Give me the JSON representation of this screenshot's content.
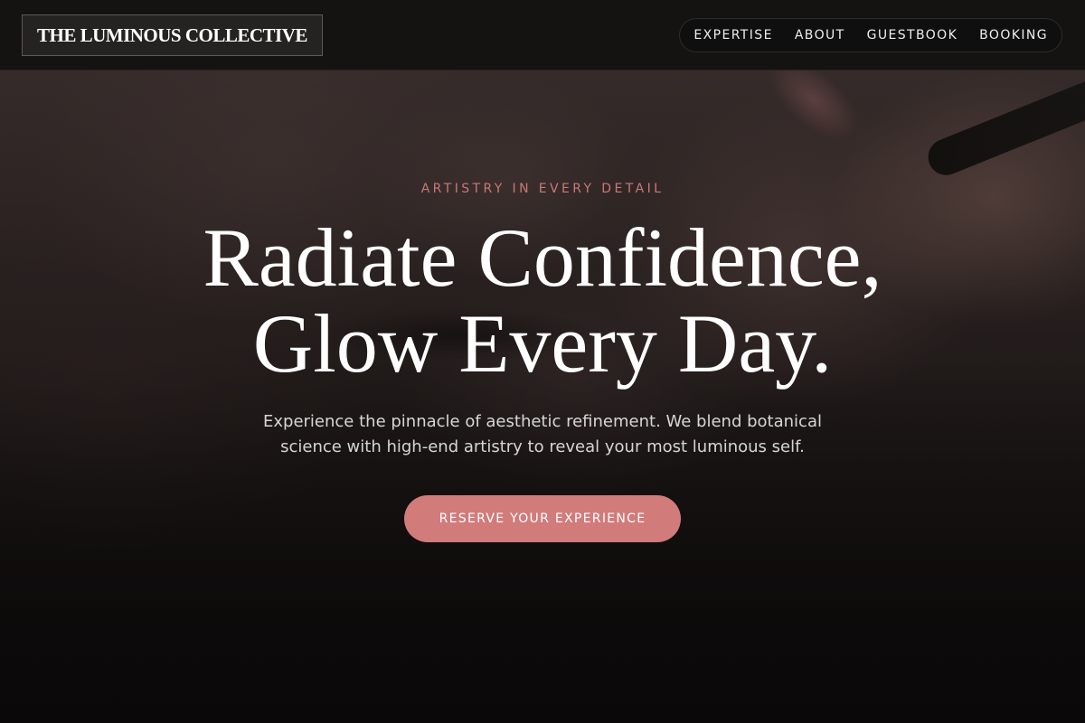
{
  "header": {
    "logo_text": "THE LUMINOUS COLLECTIVE",
    "nav": [
      {
        "label": "EXPERTISE"
      },
      {
        "label": "ABOUT"
      },
      {
        "label": "GUESTBOOK"
      },
      {
        "label": "BOOKING"
      }
    ]
  },
  "hero": {
    "eyebrow": "ARTISTRY IN EVERY DETAIL",
    "headline_line1": "Radiate Confidence,",
    "headline_line2": "Glow Every Day.",
    "subtext": "Experience the pinnacle of aesthetic refinement. We blend botanical science with high-end artistry to reveal your most luminous self.",
    "cta_label": "RESERVE YOUR EXPERIENCE"
  },
  "colors": {
    "accent": "#d27b7b",
    "eyebrow": "#c97878",
    "header_bg": "#121010",
    "page_bg": "#0e0c0c"
  }
}
